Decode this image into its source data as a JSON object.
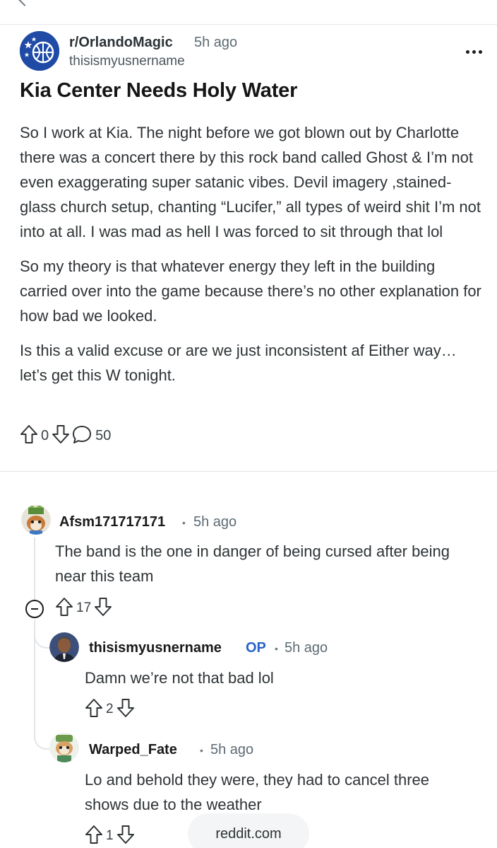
{
  "post": {
    "subreddit": "r/OrlandoMagic",
    "time": "5h ago",
    "author": "thisismyusnername",
    "title": "Kia Center Needs Holy Water",
    "body": [
      "So I work at Kia. The night before we got blown out by Charlotte there was a concert there by this rock band called Ghost & I’m not even exaggerating super satanic vibes. Devil imagery ,stained-glass church setup, chanting “Lucifer,” all types of weird shit I’m not into at all. I was mad as hell I was forced to sit through that lol",
      "So my theory is that whatever energy they left in the building carried over into the game because there’s no other explanation for how bad we looked.",
      "Is this a valid excuse or are we just inconsistent af Either way… let’s get this W tonight."
    ],
    "votes": "0",
    "comments": "50"
  },
  "comments": [
    {
      "user": "Afsm171717171",
      "time": "5h ago",
      "body": "The band is the one in danger of being cursed after being near this team",
      "votes": "17"
    },
    {
      "user": "thisismyusnername",
      "op": "OP",
      "time": "5h ago",
      "body": "Damn we’re not that bad lol",
      "votes": "2"
    },
    {
      "user": "Warped_Fate",
      "time": "5h ago",
      "body": "Lo and behold they were, they had to cancel three shows due to the weather",
      "votes": "1"
    }
  ],
  "footer": {
    "site": "reddit.com"
  },
  "colors": {
    "subreddit_avatar": "#1f4aa5",
    "op_badge": "#2a62c9",
    "divider": "#e4e6e8"
  },
  "icons": [
    "back-arrow-icon",
    "more-options-icon",
    "upvote-icon",
    "downvote-icon",
    "comment-icon",
    "collapse-thread-icon"
  ]
}
